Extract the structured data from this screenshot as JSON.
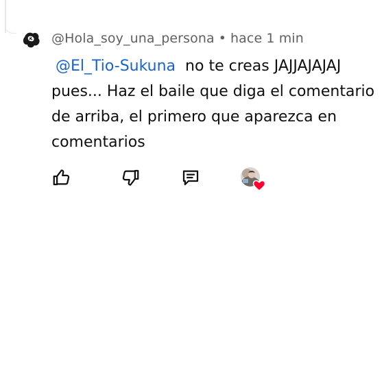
{
  "comment": {
    "author": "@Hola_soy_una_persona",
    "separator": "•",
    "timestamp": "hace 1 min",
    "mention": "@El_Tio-Sukuna",
    "line1_rest": "no te creas JAJJAJAJAJ",
    "line2": "pues... Haz el baile que diga el comentario",
    "line3": "de arriba, el primero que aparezca en",
    "line4": "comentarios"
  },
  "icons": {
    "like": "thumbs-up-icon",
    "dislike": "thumbs-down-icon",
    "reply": "comment-reply-icon",
    "creator_heart": "heart-icon"
  },
  "colors": {
    "mention": "#1a63c9",
    "meta_text": "#606060",
    "body_text": "#0f0f0f",
    "heart": "#ff0033"
  }
}
